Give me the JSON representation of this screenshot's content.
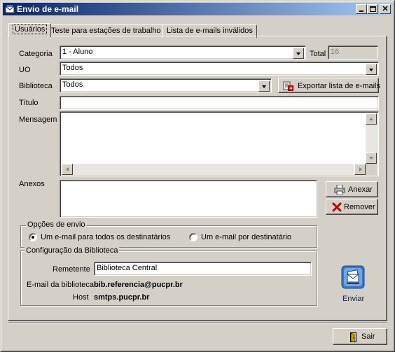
{
  "window": {
    "title": "Envio de e-mail"
  },
  "tabs": [
    {
      "label": "Usuários",
      "active": true
    },
    {
      "label": "Teste para estações de trabalho",
      "active": false
    },
    {
      "label": "Lista de e-mails inválidos",
      "active": false
    }
  ],
  "form": {
    "categoria_label": "Categoria",
    "categoria_value": "1 - Aluno",
    "total_label": "Total",
    "total_value": "16",
    "uo_label": "UO",
    "uo_value": "Todos",
    "biblioteca_label": "Biblioteca",
    "biblioteca_value": "Todos",
    "export_label": "Exportar lista de e-mails",
    "titulo_label": "Título",
    "titulo_value": "",
    "mensagem_label": "Mensagem",
    "mensagem_value": "",
    "anexos_label": "Anexos",
    "anexar_label": "Anexar",
    "remover_label": "Remover"
  },
  "opcoes": {
    "legend": "Opções de envio",
    "option1": "Um e-mail para todos os destinatários",
    "option2": "Um e-mail por destinatário",
    "selected": "option1"
  },
  "config": {
    "legend": "Configuração da Biblioteca",
    "remetente_label": "Remetente",
    "remetente_value": "Biblioteca Central",
    "email_label": "E-mail da biblioteca",
    "email_value": "bib.referencia@pucpr.br",
    "host_label": "Host",
    "host_value": "smtps.pucpr.br"
  },
  "actions": {
    "enviar_label": "Enviar",
    "sair_label": "Sair"
  },
  "colors": {
    "titlebar_start": "#0a246a",
    "titlebar_end": "#a6caf0",
    "face": "#d4d0c8",
    "link_blue": "#0a246a"
  }
}
